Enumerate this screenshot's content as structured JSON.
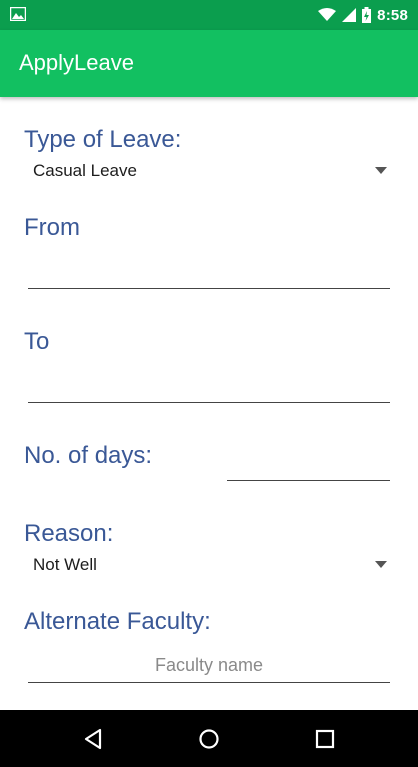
{
  "status_bar": {
    "time": "8:58",
    "icons": [
      "image-notification-icon",
      "wifi-icon",
      "cell-signal-icon",
      "battery-charging-icon"
    ]
  },
  "app_bar": {
    "title": "ApplyLeave"
  },
  "form": {
    "type_of_leave": {
      "label": "Type of Leave:",
      "selected": "Casual Leave"
    },
    "from": {
      "label": "From",
      "value": ""
    },
    "to": {
      "label": "To",
      "value": ""
    },
    "no_of_days": {
      "label": "No. of days:",
      "value": ""
    },
    "reason": {
      "label": "Reason:",
      "selected": "Not Well"
    },
    "alternate_faculty": {
      "label": "Alternate Faculty:",
      "placeholder": "Faculty name"
    }
  },
  "nav_bar": {
    "icons": [
      "back-icon",
      "home-icon",
      "recents-icon"
    ]
  },
  "colors": {
    "status_bar": "#0b9e4e",
    "app_bar": "#12c061",
    "label": "#3a5896"
  }
}
